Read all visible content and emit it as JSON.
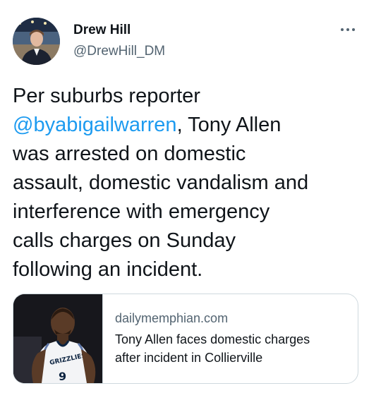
{
  "author": {
    "display_name": "Drew Hill",
    "handle": "@DrewHill_DM",
    "avatar_icon": "profile-photo"
  },
  "more_icon": "ellipsis-icon",
  "tweet": {
    "lines": [
      "Per suburbs reporter",
      "{mention}, Tony Allen",
      "was arrested on domestic",
      "assault, domestic vandalism and",
      "interference with emergency",
      "calls charges on Sunday",
      "following an incident."
    ],
    "mention": "@byabigailwarren",
    "after_mention": ", Tony Allen"
  },
  "link_card": {
    "domain": "dailymemphian.com",
    "title_lines": [
      "Tony Allen faces domestic charges",
      "after incident in Collierville"
    ],
    "jersey_text": "GRIZZLIES",
    "jersey_number": "9"
  },
  "colors": {
    "link": "#1d9bf0",
    "secondary_text": "#536471",
    "primary_text": "#0f1419",
    "border": "#cfd9de"
  }
}
